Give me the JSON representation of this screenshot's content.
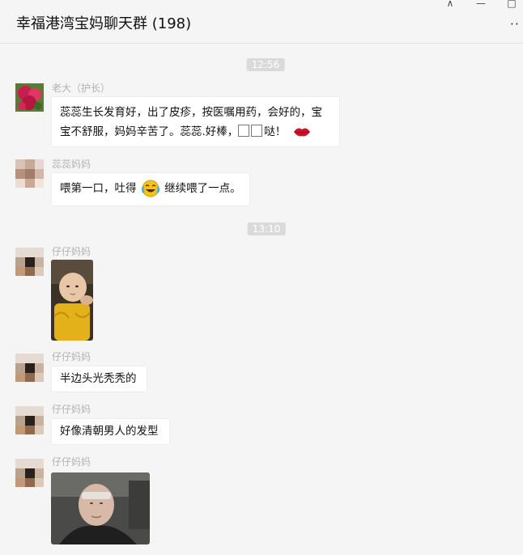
{
  "window": {
    "title": "幸福港湾宝妈聊天群 (198)",
    "pin_glyph": "⊼",
    "minimize_glyph": "—",
    "maximize_glyph": "□",
    "more_glyph": "··"
  },
  "chat": {
    "timestamps": [
      "12:56",
      "13:10"
    ],
    "messages": [
      {
        "sender": "老大（护长）",
        "text": "蕊蕊生长发育好，出了皮疹，按医嘱用药，会好的，宝宝不舒服，妈妈辛苦了。蕊蕊.好棒，",
        "text_tail": "哒！"
      },
      {
        "sender": "蕊蕊妈妈",
        "text_a": "喂第一口，吐得",
        "text_b": "继续喂了一点。"
      },
      {
        "sender": "仔仔妈妈"
      },
      {
        "sender": "仔仔妈妈",
        "text": "半边头光秃秃的"
      },
      {
        "sender": "仔仔妈妈",
        "text": "好像清朝男人的发型"
      },
      {
        "sender": "仔仔妈妈"
      }
    ]
  }
}
